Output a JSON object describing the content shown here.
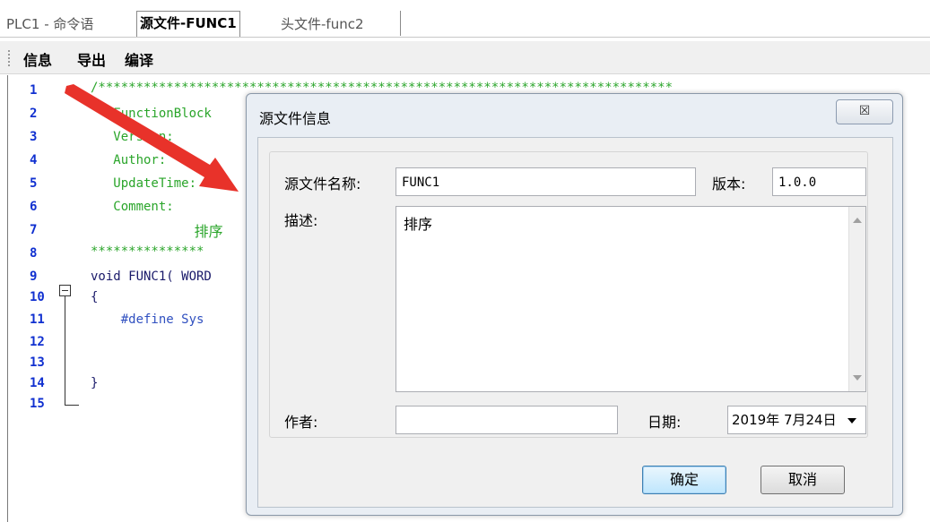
{
  "tabs": [
    {
      "label": "PLC1 - 命令语"
    },
    {
      "label": "源文件-FUNC1"
    },
    {
      "label": "头文件-func2"
    }
  ],
  "toolbar": {
    "info": "信息",
    "export": "导出",
    "compile": "编译"
  },
  "editor": {
    "line_numbers": [
      "1",
      "2",
      "3",
      "4",
      "5",
      "6",
      "7",
      "8",
      "9",
      "10",
      "11",
      "12",
      "13",
      "14",
      "15"
    ],
    "lines": [
      "/****************************************************************************",
      "   FunctionBlock",
      "   Version:",
      "   Author:",
      "   UpdateTime:",
      "   Comment:",
      "            排序",
      "***************",
      "void FUNC1( WORD",
      "{",
      "    #define Sys",
      "",
      "",
      "}",
      ""
    ]
  },
  "dialog": {
    "title": "源文件信息",
    "close_glyph": "☒",
    "name_label": "源文件名称:",
    "name_value": "FUNC1",
    "version_label": "版本:",
    "version_value": "1.0.0",
    "desc_label": "描述:",
    "desc_value": "排序",
    "author_label": "作者:",
    "author_value": "",
    "date_label": "日期:",
    "date_value": "2019年 7月24日",
    "ok_label": "确定",
    "cancel_label": "取消"
  },
  "colors": {
    "arrow": "#e8322a",
    "comment": "#2aa52a",
    "keyword": "#3050c0",
    "line_number": "#1030d0"
  }
}
